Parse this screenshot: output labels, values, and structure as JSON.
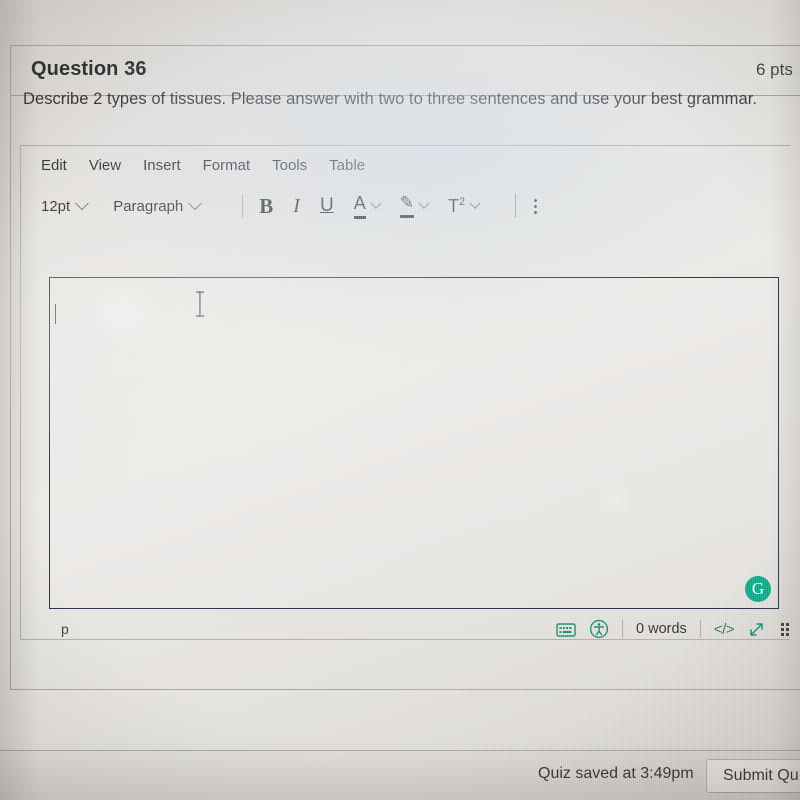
{
  "question": {
    "name": "Question 36",
    "points": "6 pts",
    "prompt": "Describe 2 types of tissues. Please answer with two to three sentences and use your best grammar."
  },
  "editor": {
    "menubar": [
      {
        "label": "Edit"
      },
      {
        "label": "View"
      },
      {
        "label": "Insert"
      },
      {
        "label": "Format"
      },
      {
        "label": "Tools"
      },
      {
        "label": "Table"
      }
    ],
    "toolbar": {
      "font_size": "12pt",
      "block_format": "Paragraph",
      "bold": "B",
      "italic": "I",
      "underline": "U",
      "text_color": "A",
      "highlight": "✎",
      "superscript": "T",
      "superscript_exponent": "2",
      "overflow": "more-options"
    },
    "content": "",
    "grammarly_badge": "G",
    "status": {
      "element_path": "p",
      "keyboard_icon": "keyboard-shortcuts-icon",
      "accessibility_icon": "accessibility-checker-icon",
      "word_count": "0 words",
      "html_editor": "</>",
      "fullscreen": "fullscreen-icon",
      "resize_grip": "resize-handle"
    }
  },
  "footer": {
    "save_status": "Quiz saved at 3:49pm",
    "submit_label": "Submit Qu"
  },
  "colors": {
    "accent_teal": "#1d7e67",
    "grammarly_green": "#17a07a",
    "editor_border": "#2d3142",
    "text": "#2e2e2e"
  }
}
